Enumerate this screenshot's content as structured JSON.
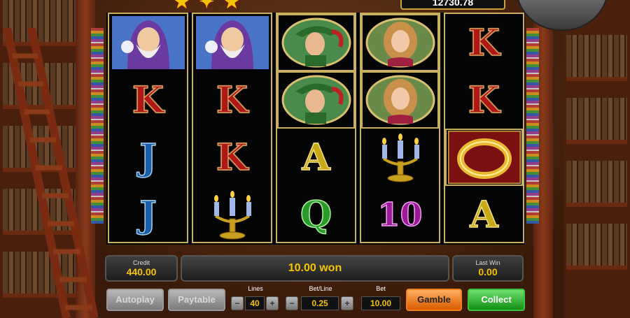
{
  "game": {
    "jackpot_value": "12730.78"
  },
  "reels": [
    {
      "symbols": [
        "wizard",
        "K",
        "J",
        "J"
      ]
    },
    {
      "symbols": [
        "wizard",
        "K",
        "K",
        "candelabra"
      ]
    },
    {
      "symbols": [
        "hero",
        "hero",
        "A",
        "Q"
      ]
    },
    {
      "symbols": [
        "lady",
        "lady",
        "candelabra",
        "10"
      ]
    },
    {
      "symbols": [
        "K",
        "K",
        "ring",
        "A"
      ]
    }
  ],
  "symbol_text": {
    "K": "K",
    "J": "J",
    "A": "A",
    "Q": "Q",
    "10": "10"
  },
  "panel": {
    "credit_label": "Credit",
    "credit_value": "440.00",
    "message": "10.00 won",
    "last_win_label": "Last Win",
    "last_win_value": "0.00",
    "autoplay_label": "Autoplay",
    "paytable_label": "Paytable",
    "lines_label": "Lines",
    "lines_value": "40",
    "betline_label": "Bet/Line",
    "betline_value": "0.25",
    "bet_label": "Bet",
    "bet_value": "10.00",
    "gamble_label": "Gamble",
    "collect_label": "Collect",
    "minus": "−",
    "plus": "+"
  },
  "colors": {
    "gold": "#f5c400",
    "reel_border": "#c8b060",
    "gamble": "#e86a10",
    "collect": "#20a020"
  },
  "icons": [
    "wizard-symbol",
    "hero-symbol",
    "lady-symbol",
    "candelabra-symbol",
    "ring-symbol"
  ]
}
